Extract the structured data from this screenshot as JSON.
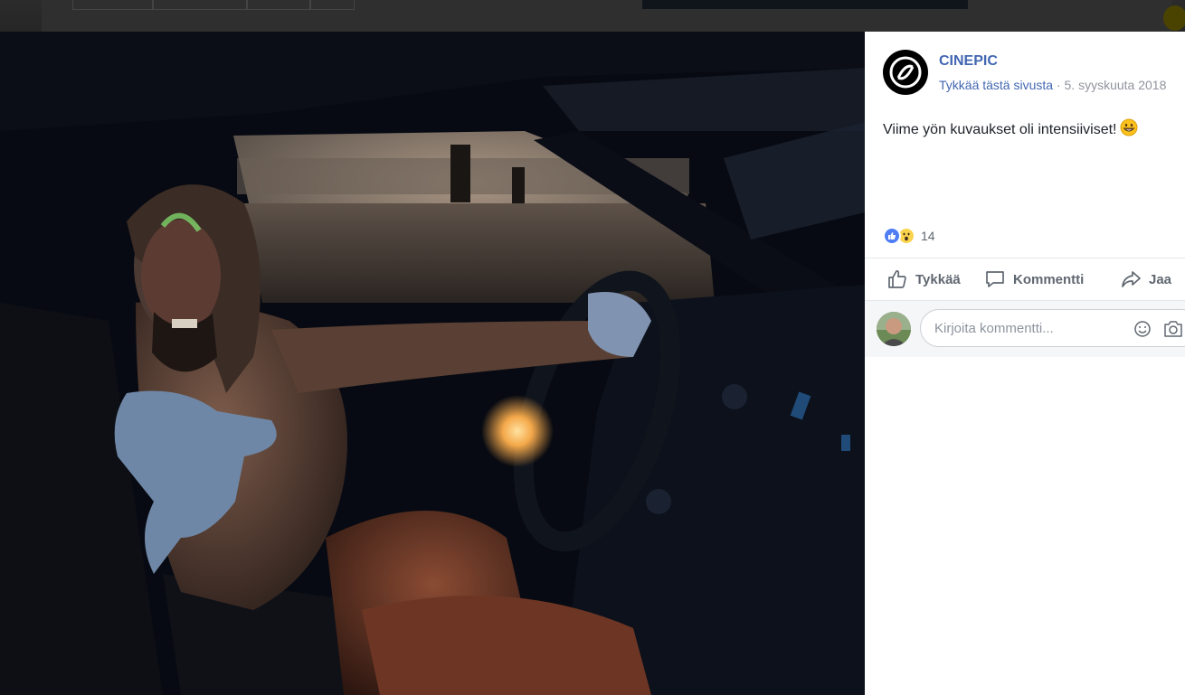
{
  "post": {
    "page_name": "CINEPIC",
    "like_page": "Tykkää tästä sivusta",
    "separator": "·",
    "date": "5. syyskuuta 2018",
    "text": "Viime yön kuvaukset oli intensiiviset!",
    "emoji": "grinning-face-emoji",
    "reaction_count": "14",
    "reaction_types": [
      "like",
      "wow"
    ]
  },
  "actions": {
    "like_label": "Tykkää",
    "comment_label": "Kommentti",
    "share_label": "Jaa"
  },
  "comment_box": {
    "placeholder": "Kirjoita kommentti...",
    "icons": [
      "emoji-icon",
      "camera-icon"
    ]
  },
  "colors": {
    "link": "#4267b2",
    "muted": "#90949c",
    "like_blue": "#4f7df3",
    "wow_yellow": "#fcd34d"
  }
}
